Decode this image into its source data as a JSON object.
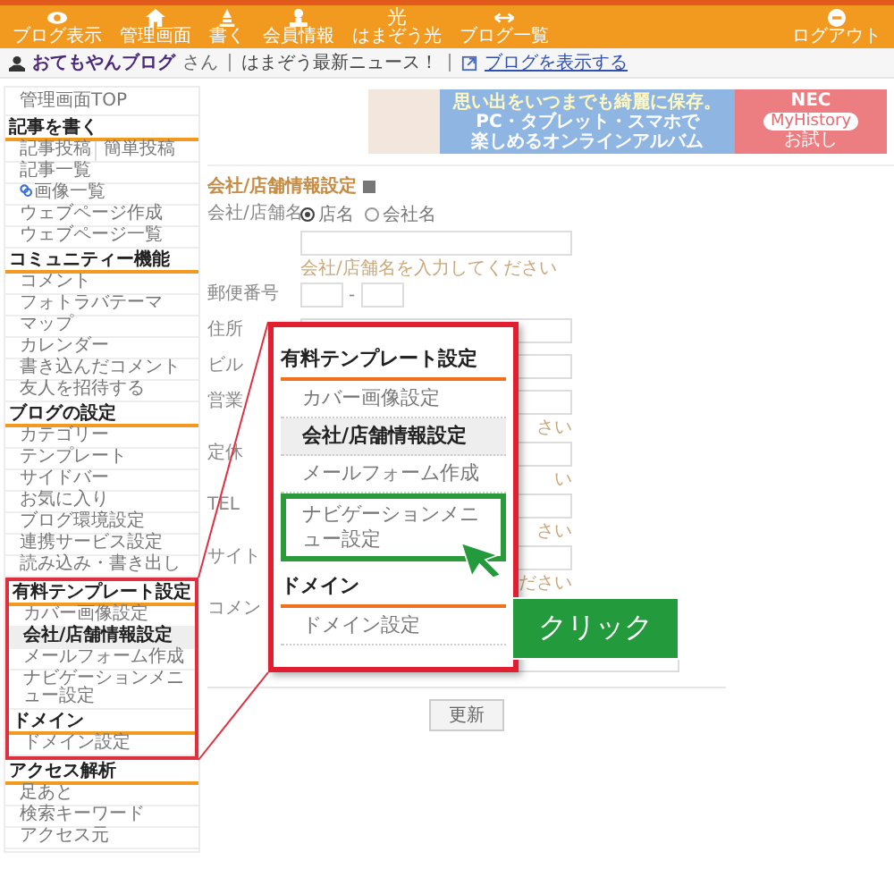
{
  "top_nav": {
    "items": [
      {
        "kind": "eye",
        "label": "ブログ表示"
      },
      {
        "kind": "home",
        "label": "管理画面"
      },
      {
        "kind": "pen",
        "label": "書く"
      },
      {
        "kind": "person",
        "label": "会員情報"
      },
      {
        "kind": "glyph",
        "glyph": "光",
        "label": "はまぞう光"
      },
      {
        "kind": "arrows",
        "label": "ブログ一覧"
      }
    ],
    "logout": "ログアウト"
  },
  "user_bar": {
    "blog_name": "おてもやんブログ",
    "suffix": "さん",
    "news": "はまぞう最新ニュース！",
    "link": "ブログを表示する"
  },
  "sidebar": {
    "top_item": "管理画面TOP",
    "sections": [
      {
        "title": "記事を書く",
        "highlighted": false,
        "items": [
          {
            "label": "記事投稿",
            "extra": "簡単投稿",
            "selected": false
          },
          {
            "label": "記事一覧",
            "selected": false
          },
          {
            "label": "画像一覧",
            "selected": false
          },
          {
            "label": "ウェブページ作成",
            "selected": false
          },
          {
            "label": "ウェブページ一覧",
            "selected": false
          }
        ]
      },
      {
        "title": "コミュニティー機能",
        "highlighted": false,
        "items": [
          {
            "label": "コメント",
            "selected": false
          },
          {
            "label": "フォトラバテーマ",
            "selected": false
          },
          {
            "label": "マップ",
            "selected": false
          },
          {
            "label": "カレンダー",
            "selected": false
          },
          {
            "label": "書き込んだコメント",
            "selected": false
          },
          {
            "label": "友人を招待する",
            "selected": false
          }
        ]
      },
      {
        "title": "ブログの設定",
        "highlighted": false,
        "items": [
          {
            "label": "カテゴリー",
            "selected": false
          },
          {
            "label": "テンプレート",
            "selected": false
          },
          {
            "label": "サイドバー",
            "selected": false
          },
          {
            "label": "お気に入り",
            "selected": false
          },
          {
            "label": "ブログ環境設定",
            "selected": false
          },
          {
            "label": "連携サービス設定",
            "selected": false
          },
          {
            "label": "読み込み・書き出し",
            "selected": false
          }
        ]
      },
      {
        "title": "有料テンプレート設定",
        "highlighted": true,
        "items": [
          {
            "label": "カバー画像設定",
            "selected": false
          },
          {
            "label": "会社/店舗情報設定",
            "selected": true
          },
          {
            "label": "メールフォーム作成",
            "selected": false
          },
          {
            "label": "ナビゲーションメニュー設定",
            "selected": false
          }
        ]
      },
      {
        "title": "ドメイン",
        "highlighted": true,
        "items": [
          {
            "label": "ドメイン設定",
            "selected": false
          }
        ]
      },
      {
        "title": "アクセス解析",
        "highlighted": false,
        "items": [
          {
            "label": "足あと",
            "selected": false
          },
          {
            "label": "検索キーワード",
            "selected": false
          },
          {
            "label": "アクセス元",
            "selected": false
          }
        ]
      }
    ]
  },
  "banner": {
    "lines": [
      "思い出をいつまでも綺麗に保存。",
      "PC・タブレット・スマホで",
      "楽しめるオンラインアルバム"
    ],
    "brand": "NEC",
    "product": "MyHistory",
    "cta": "お試し"
  },
  "form": {
    "title": "会社/店舗情報設定",
    "fields": [
      {
        "kind": "radio_text",
        "label": "会社/店舗名",
        "options": [
          {
            "label": "店名",
            "selected": true
          },
          {
            "label": "会社名",
            "selected": false
          }
        ],
        "hint": "会社/店舗名を入力してください"
      },
      {
        "kind": "postal",
        "label": "郵便番号",
        "separator": "-"
      },
      {
        "kind": "text",
        "label": "住所"
      },
      {
        "kind": "text",
        "label": "ビル"
      },
      {
        "kind": "text",
        "label": "営業",
        "hint": "さい"
      },
      {
        "kind": "text",
        "label": "定休",
        "hint": "い"
      },
      {
        "kind": "text",
        "label": "TEL",
        "hint": "さい"
      },
      {
        "kind": "text",
        "label": "サイト",
        "hint": "ださい"
      },
      {
        "kind": "textarea",
        "label": "コメン"
      }
    ],
    "submit": "更新"
  },
  "callout": {
    "sections": [
      {
        "title": "有料テンプレート設定",
        "items": [
          {
            "label": "カバー画像設定",
            "selected": false,
            "highlighted": false
          },
          {
            "label": "会社/店舗情報設定",
            "selected": true,
            "highlighted": false
          },
          {
            "label": "メールフォーム作成",
            "selected": false,
            "highlighted": false
          },
          {
            "label": "ナビゲーションメニュー設定",
            "selected": false,
            "highlighted": true
          }
        ]
      },
      {
        "title": "ドメイン",
        "items": [
          {
            "label": "ドメイン設定",
            "selected": false,
            "highlighted": false
          }
        ]
      }
    ],
    "action_label": "クリック"
  }
}
